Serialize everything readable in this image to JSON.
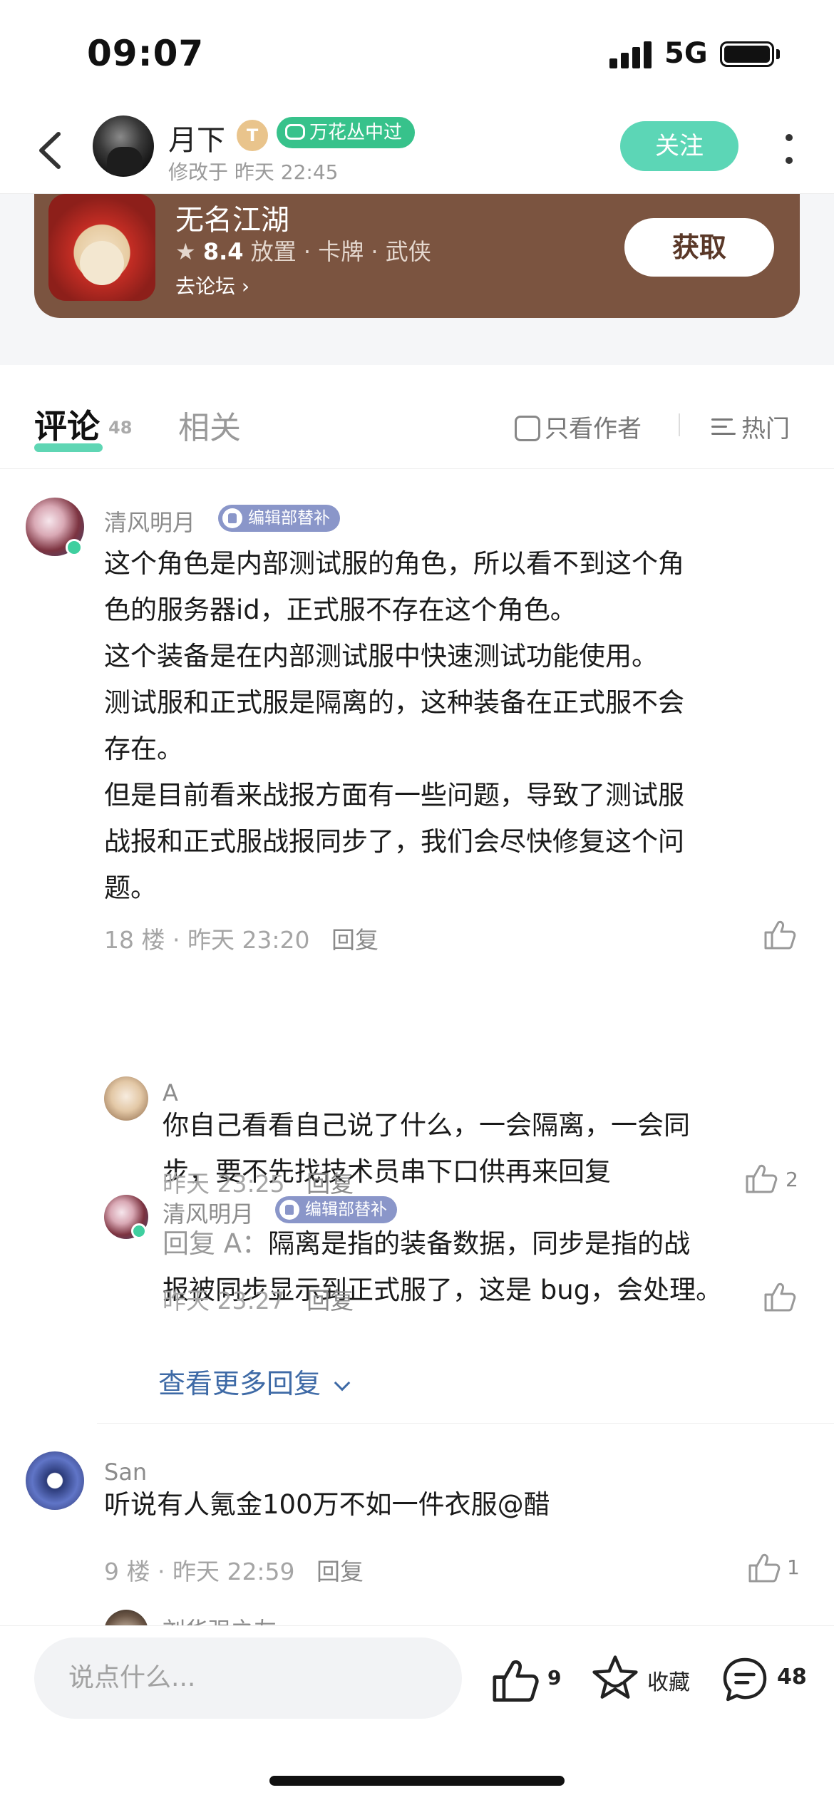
{
  "status_bar": {
    "time": "09:07",
    "network": "5G"
  },
  "header": {
    "author_name": "月下",
    "level_badge": "T",
    "tag_badge": "万花丛中过",
    "edit_time": "修改于 昨天 22:45",
    "follow_label": "关注"
  },
  "game_card": {
    "title": "无名江湖",
    "score": "8.4",
    "genres": "放置 · 卡牌 · 武侠",
    "forum_link": "去论坛",
    "get_label": "获取"
  },
  "tabs": {
    "comment_label": "评论",
    "comment_count": "48",
    "related_label": "相关",
    "only_author_label": "只看作者",
    "sort_label": "热门"
  },
  "comments": [
    {
      "name": "清风明月",
      "badge": "编辑部替补",
      "text": "这个角色是内部测试服的角色，所以看不到这个角色的服务器id，正式服不存在这个角色。\n这个装备是在内部测试服中快速测试功能使用。\n测试服和正式服是隔离的，这种装备在正式服不会存在。\n但是目前看来战报方面有一些问题，导致了测试服战报和正式服战报同步了，我们会尽快修复这个问题。",
      "lines": [
        "这个角色是内部测试服的角色，所以看不到这个角",
        "色的服务器id，正式服不存在这个角色。",
        "这个装备是在内部测试服中快速测试功能使用。",
        "测试服和正式服是隔离的，这种装备在正式服不会",
        "存在。",
        "但是目前看来战报方面有一些问题，导致了测试服",
        "战报和正式服战报同步了，我们会尽快修复这个问",
        "题。"
      ],
      "meta": "18 楼 · 昨天 23:20",
      "reply_label": "回复",
      "replies": [
        {
          "name": "A",
          "lines": [
            "你自己看看自己说了什么，一会隔离，一会同",
            "步，要不先找技术员串下口供再来回复"
          ],
          "meta": "昨天 23:25",
          "reply_label": "回复",
          "likes": "2"
        },
        {
          "name": "清风明月",
          "badge": "编辑部替补",
          "reply_prefix": "回复 A：",
          "lines": [
            "隔离是指的装备数据，同步是指的战",
            "报被同步显示到正式服了，这是 bug，会处理。"
          ],
          "meta": "昨天 23:27",
          "reply_label": "回复"
        }
      ],
      "view_more": "查看更多回复"
    },
    {
      "name": "San",
      "text": "听说有人氪金100万不如一件衣服@醋",
      "meta": "9 楼 · 昨天 22:59",
      "reply_label": "回复",
      "likes": "1"
    },
    {
      "name": "刘华强之友"
    }
  ],
  "bottom_bar": {
    "input_placeholder": "说点什么...",
    "like_count": "9",
    "favorite_label": "收藏",
    "comment_count": "48"
  },
  "colors": {
    "accent_green": "#5cd6b6",
    "card_brown": "#7b5440",
    "link_blue": "#3e6aa6",
    "edit_badge": "#8a96c9"
  }
}
